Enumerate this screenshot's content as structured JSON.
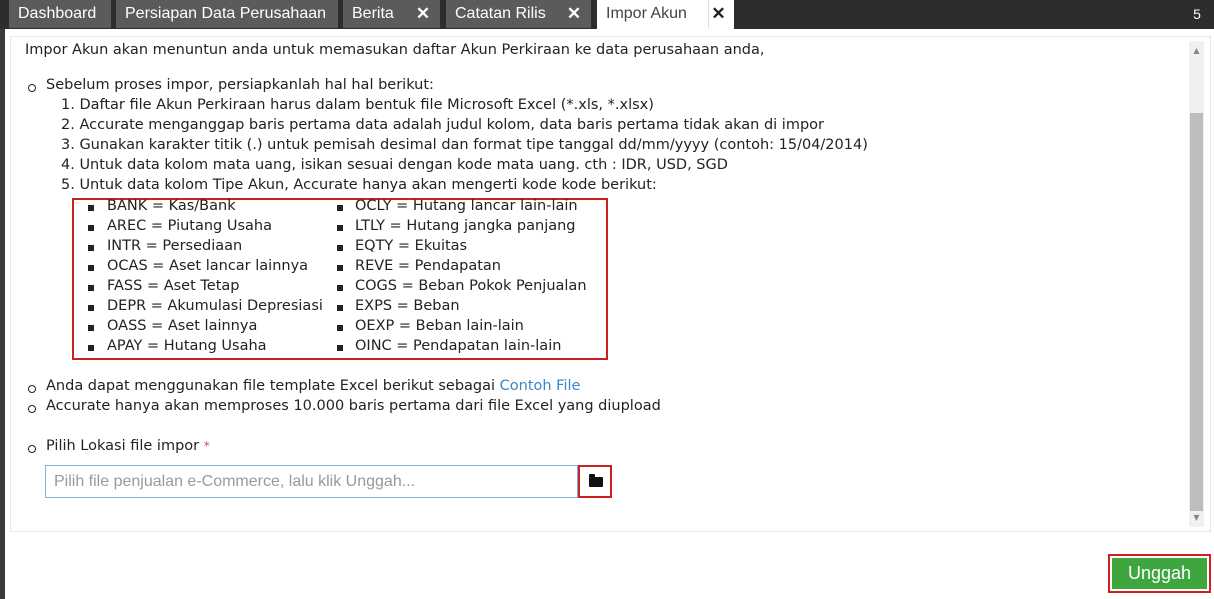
{
  "tabs": [
    {
      "label": "Dashboard",
      "closable": false
    },
    {
      "label": "Persiapan Data Perusahaan",
      "closable": false
    },
    {
      "label": "Berita",
      "closable": true
    },
    {
      "label": "Catatan Rilis",
      "closable": true
    },
    {
      "label": "Impor Akun",
      "closable": true,
      "active": true
    }
  ],
  "tab_count": "5",
  "intro": "Impor Akun akan menuntun anda untuk memasukan daftar Akun Perkiraan ke data perusahaan anda,",
  "prep_heading": "Sebelum proses impor, persiapkanlah hal hal berikut:",
  "steps": [
    "1. Daftar file Akun Perkiraan harus dalam bentuk file Microsoft Excel (*.xls, *.xlsx)",
    "2. Accurate menganggap baris pertama data adalah judul kolom, data baris pertama tidak akan di impor",
    "3. Gunakan karakter titik (.) untuk pemisah desimal dan format tipe tanggal dd/mm/yyyy (contoh: 15/04/2014)",
    "4. Untuk data kolom mata uang, isikan sesuai dengan kode mata uang. cth : IDR, USD, SGD",
    "5. Untuk data kolom Tipe Akun, Accurate hanya akan mengerti kode kode berikut:"
  ],
  "account_types_left": [
    "BANK = Kas/Bank",
    "AREC = Piutang Usaha",
    "INTR = Persediaan",
    "OCAS = Aset lancar lainnya",
    "FASS = Aset Tetap",
    "DEPR = Akumulasi Depresiasi",
    "OASS = Aset lainnya",
    "APAY = Hutang Usaha"
  ],
  "account_types_right": [
    "OCLY = Hutang lancar lain-lain",
    "LTLY = Hutang jangka panjang",
    "EQTY = Ekuitas",
    "REVE = Pendapatan",
    "COGS = Beban Pokok Penjualan",
    "EXPS = Beban",
    "OEXP = Beban lain-lain",
    "OINC = Pendapatan lain-lain"
  ],
  "template_text": "Anda dapat menggunakan file template Excel berikut sebagai",
  "template_link": "Contoh File",
  "limit_text": "Accurate hanya akan memproses 10.000 baris pertama dari file Excel yang diupload",
  "file_label": "Pilih Lokasi file impor",
  "required_mark": "*",
  "file_placeholder": "Pilih file penjualan e-Commerce, lalu klik Unggah...",
  "upload_button": "Unggah",
  "colors": {
    "accent_green": "#3fa63f",
    "highlight_red": "#cc1f1f",
    "link_blue": "#3a86c8",
    "tab_bg": "#5b5b5b"
  }
}
